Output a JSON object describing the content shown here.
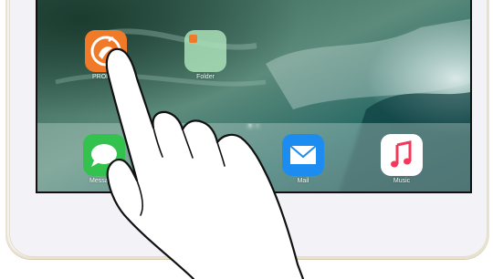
{
  "home_screen": {
    "apps": [
      {
        "label": "PROMPT",
        "icon": "prompt-app-icon"
      },
      {
        "label": "Folder",
        "icon": "folder-icon"
      }
    ]
  },
  "dock": {
    "apps": [
      {
        "label": "Messages",
        "icon": "messages-icon"
      },
      {
        "label": "Mail",
        "icon": "mail-icon"
      },
      {
        "label": "Music",
        "icon": "music-icon"
      }
    ]
  },
  "gesture": {
    "icon": "pointing-hand-icon"
  },
  "colors": {
    "prompt_orange": "#f07a27",
    "messages_green": "#32c24d",
    "mail_blue": "#1d8cf0",
    "music_pink": "#f5375b",
    "folder_green": "#9ad7a6"
  }
}
